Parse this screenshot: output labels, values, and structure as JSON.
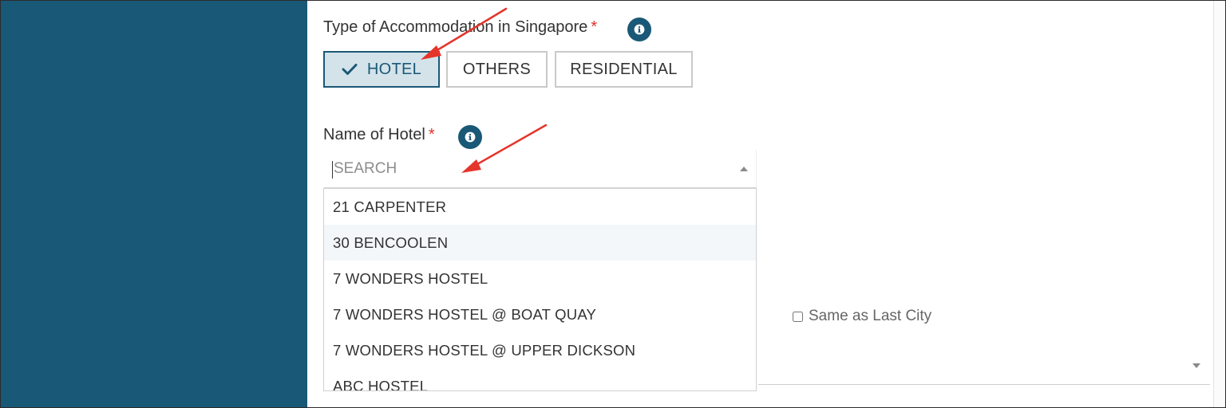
{
  "accommodation": {
    "label": "Type of Accommodation in Singapore",
    "required_mark": "*",
    "info_icon": "info-icon",
    "options": [
      {
        "label": "HOTEL",
        "selected": true
      },
      {
        "label": "OTHERS",
        "selected": false
      },
      {
        "label": "RESIDENTIAL",
        "selected": false
      }
    ]
  },
  "hotel": {
    "label": "Name of Hotel",
    "required_mark": "*",
    "info_icon": "info-icon",
    "search_placeholder": "SEARCH",
    "options": [
      "21 CARPENTER",
      "30 BENCOOLEN",
      "7 WONDERS HOSTEL",
      "7 WONDERS HOSTEL @ BOAT QUAY",
      "7 WONDERS HOSTEL @ UPPER DICKSON",
      "ABC HOSTEL"
    ],
    "highlighted_option_index": 1
  },
  "last_city": {
    "checkbox_label": "Same as Last City",
    "checked": false
  },
  "colors": {
    "sidebar": "#1a5877",
    "accent": "#1a5877",
    "selected_bg": "#d4e3ea",
    "required": "#e0302b",
    "annotation_arrow": "#e5352b"
  }
}
